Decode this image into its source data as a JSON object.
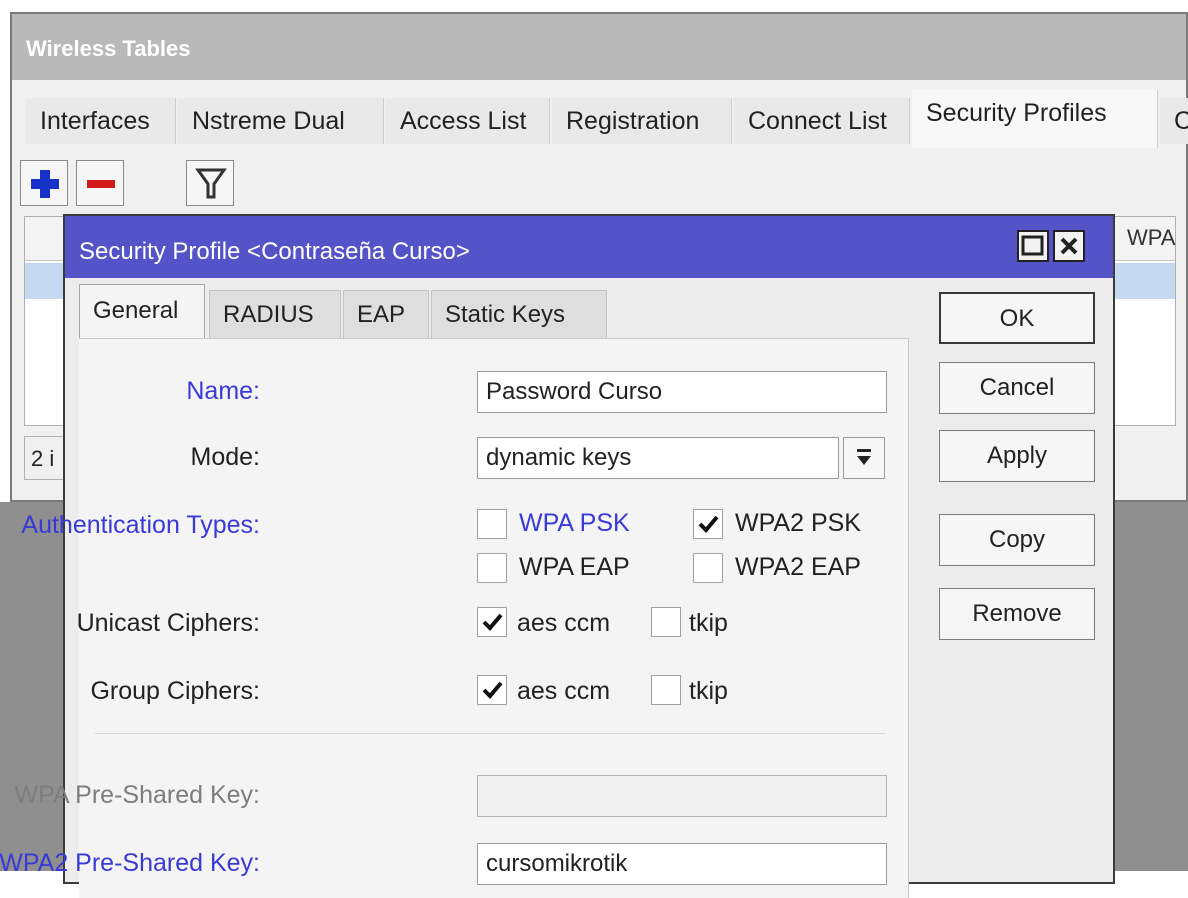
{
  "app": {
    "title": "Wireless Tables",
    "tabs": [
      {
        "label": "Interfaces",
        "active": false
      },
      {
        "label": "Nstreme Dual",
        "active": false
      },
      {
        "label": "Access List",
        "active": false
      },
      {
        "label": "Registration",
        "active": false
      },
      {
        "label": "Connect List",
        "active": false
      },
      {
        "label": "Security Profiles",
        "active": true
      },
      {
        "label": "C",
        "active": false
      }
    ],
    "toolbar": {
      "add_icon": "plus-icon",
      "remove_icon": "minus-icon",
      "filter_icon": "filter-icon"
    },
    "table": {
      "visible_column": "WPA",
      "status_text": "2 i"
    }
  },
  "dialog": {
    "title": "Security Profile <Contraseña Curso>",
    "tabs": [
      {
        "label": "General",
        "active": true
      },
      {
        "label": "RADIUS",
        "active": false
      },
      {
        "label": "EAP",
        "active": false
      },
      {
        "label": "Static Keys",
        "active": false
      }
    ],
    "fields": {
      "name": {
        "label": "Name:",
        "value": "Password Curso"
      },
      "mode": {
        "label": "Mode:",
        "value": "dynamic keys"
      },
      "auth_types": {
        "label": "Authentication Types:",
        "options": [
          {
            "label": "WPA PSK",
            "checked": false
          },
          {
            "label": "WPA2 PSK",
            "checked": true
          },
          {
            "label": "WPA EAP",
            "checked": false
          },
          {
            "label": "WPA2 EAP",
            "checked": false
          }
        ]
      },
      "unicast_ciphers": {
        "label": "Unicast Ciphers:",
        "options": [
          {
            "label": "aes ccm",
            "checked": true
          },
          {
            "label": "tkip",
            "checked": false
          }
        ]
      },
      "group_ciphers": {
        "label": "Group Ciphers:",
        "options": [
          {
            "label": "aes ccm",
            "checked": true
          },
          {
            "label": "tkip",
            "checked": false
          }
        ]
      },
      "wpa_psk": {
        "label": "WPA Pre-Shared Key:",
        "value": ""
      },
      "wpa2_psk": {
        "label": "WPA2 Pre-Shared Key:",
        "value": "cursomikrotik"
      }
    },
    "buttons": {
      "ok": "OK",
      "cancel": "Cancel",
      "apply": "Apply",
      "copy": "Copy",
      "remove": "Remove"
    }
  },
  "colors": {
    "dialog_title_bar": "#5453c8",
    "blue_label": "#3939d8",
    "selected_row": "#c6d9f3"
  }
}
